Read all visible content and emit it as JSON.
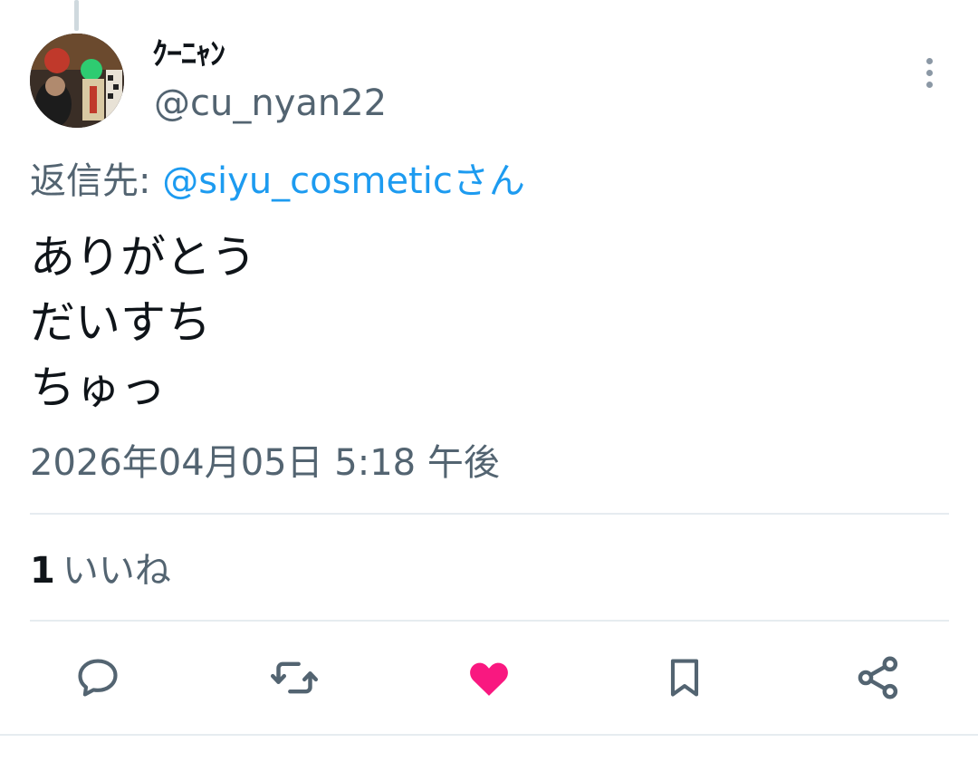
{
  "tweet": {
    "author": {
      "display_name": "ｸｰﾆｬﾝ",
      "handle": "@cu_nyan22"
    },
    "reply_to": {
      "prefix": "返信先: ",
      "mention": "@siyu_cosmeticさん"
    },
    "body_lines": [
      "ありがとう",
      "だいすち",
      "ちゅっ"
    ],
    "timestamp": "2026年04月05日 5:18 午後",
    "likes": {
      "count": "1",
      "label": "いいね"
    },
    "liked": true
  },
  "icons": {
    "more": "more-vertical-icon",
    "reply": "reply-icon",
    "retweet": "retweet-icon",
    "like": "heart-icon",
    "bookmark": "bookmark-icon",
    "share": "share-icon"
  },
  "colors": {
    "text_primary": "#0f1419",
    "text_secondary": "#536471",
    "link": "#1d9bf0",
    "like": "#f91880",
    "icon": "#536471",
    "divider": "#e6ecf0"
  }
}
